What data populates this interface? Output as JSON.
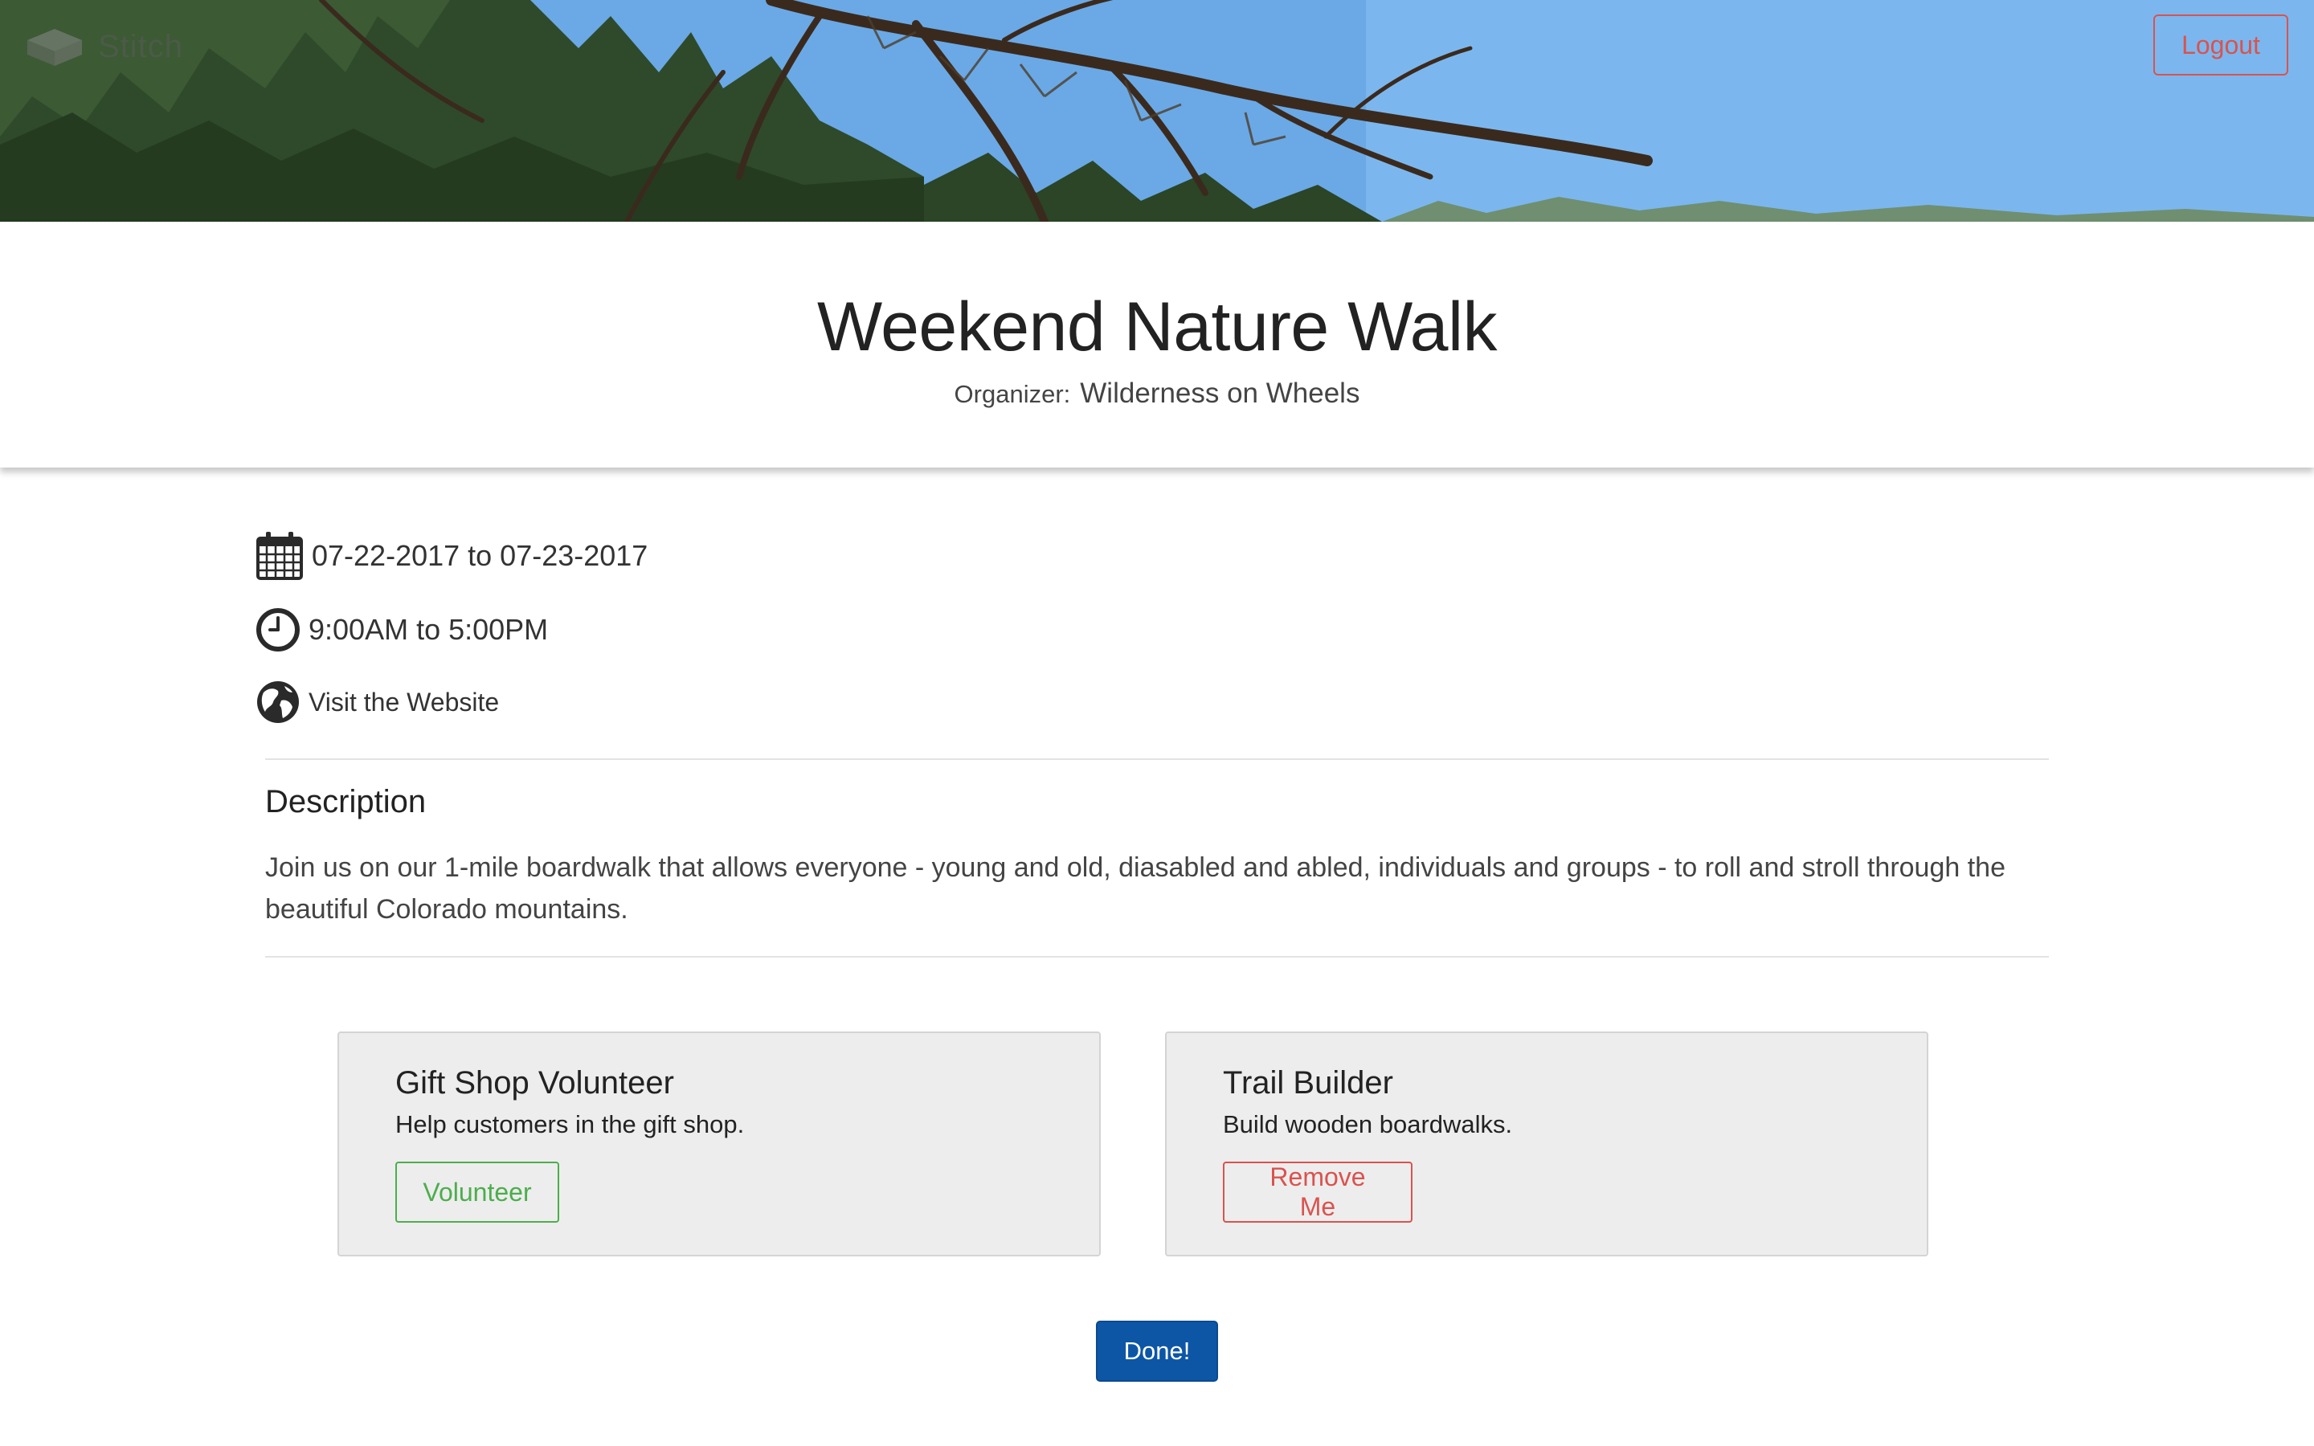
{
  "header": {
    "brand_name": "Stitch",
    "brand_icon": "box-stack-icon",
    "logout_label": "Logout",
    "banner_image": "pine branches against blue sky"
  },
  "event": {
    "title": "Weekend Nature Walk",
    "organizer_label": "Organizer:",
    "organizer_name": "Wilderness on Wheels"
  },
  "details": {
    "date_icon": "calendar-icon",
    "date_range": "07-22-2017 to 07-23-2017",
    "time_icon": "clock-icon",
    "time_range": "9:00AM to 5:00PM",
    "website_icon": "globe-icon",
    "website_label": "Visit the Website"
  },
  "description": {
    "heading": "Description",
    "text": "Join us on our 1-mile boardwalk that allows everyone - young and old, diasabled and abled, individuals and groups - to roll and stroll through the beautiful Colorado mountains."
  },
  "roles": [
    {
      "title": "Gift Shop Volunteer",
      "description": "Help customers in the gift shop.",
      "action_label": "Volunteer"
    },
    {
      "title": "Trail Builder",
      "description": "Build wooden boardwalks.",
      "action_label": "Remove Me"
    }
  ],
  "footer": {
    "done_label": "Done!"
  },
  "colors": {
    "danger": "#d9534f",
    "success": "#4cae4c",
    "primary": "#0d56a6",
    "card_bg": "#ededed"
  }
}
